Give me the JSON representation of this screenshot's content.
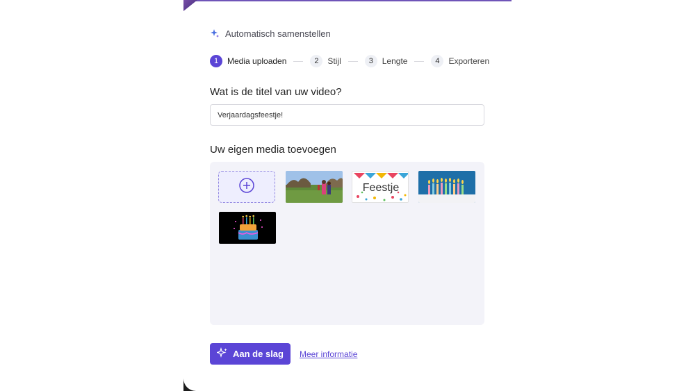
{
  "header": {
    "title": "Automatisch samenstellen",
    "icon": "sparkle-icon"
  },
  "stepper": {
    "steps": [
      {
        "number": "1",
        "label": "Media uploaden",
        "active": true
      },
      {
        "number": "2",
        "label": "Stijl",
        "active": false
      },
      {
        "number": "3",
        "label": "Lengte",
        "active": false
      },
      {
        "number": "4",
        "label": "Exporteren",
        "active": false
      }
    ]
  },
  "title_section": {
    "question": "Wat is de titel van uw video?",
    "value": "Verjaardagsfeestje!"
  },
  "media_section": {
    "heading": "Uw eigen media toevoegen",
    "add_icon": "plus-circle-icon",
    "items": [
      {
        "name": "children-on-grass-thumbnail"
      },
      {
        "name": "feestje-bunting-thumbnail",
        "text": "Feestje"
      },
      {
        "name": "birthday-candles-thumbnail"
      },
      {
        "name": "birthday-cake-thumbnail"
      }
    ]
  },
  "actions": {
    "start_label": "Aan de slag",
    "more_info_label": "Meer informatie"
  },
  "colors": {
    "accent": "#5b45d6",
    "media_bg": "#f3f3f9"
  }
}
